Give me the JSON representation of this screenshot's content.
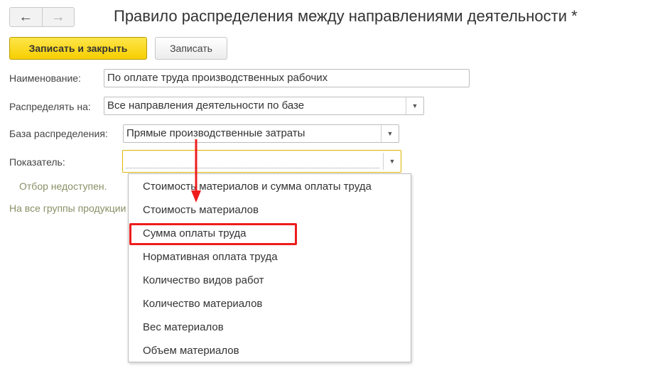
{
  "window": {
    "title": "Правило распределения между направлениями деятельности *",
    "back_icon": "←",
    "forward_icon": "→"
  },
  "toolbar": {
    "save_close_label": "Записать и закрыть",
    "save_label": "Записать"
  },
  "form": {
    "name_label": "Наименование:",
    "name_value": "По оплате труда производственных рабочих",
    "distribute_label": "Распределять на:",
    "distribute_value": "Все направления деятельности по базе",
    "base_label": "База распределения:",
    "base_value": "Прямые производственные затраты",
    "indicator_label": "Показатель:",
    "indicator_value": "",
    "filter_note": "Отбор недоступен.",
    "groups_note": "На все группы продукции"
  },
  "dropdown": {
    "options": [
      "Стоимость материалов и сумма оплаты труда",
      "Стоимость материалов",
      "Сумма оплаты труда",
      "Нормативная оплата труда",
      "Количество видов работ",
      "Количество материалов",
      "Вес материалов",
      "Объем материалов"
    ],
    "highlighted_option": "Сумма оплаты труда"
  },
  "colors": {
    "primary_button": "#f6cf00",
    "annotation_red": "#ee1c1c",
    "note_text": "#8a8f66"
  }
}
